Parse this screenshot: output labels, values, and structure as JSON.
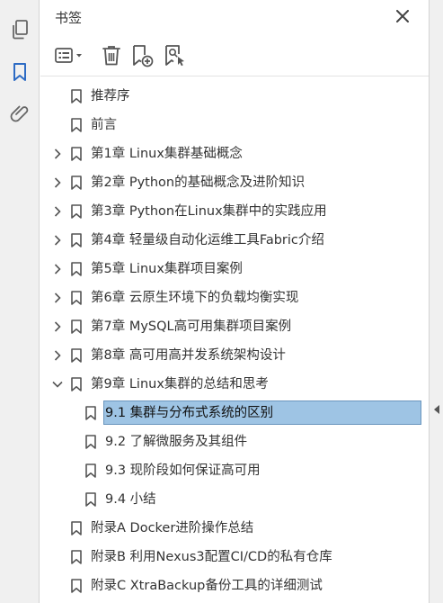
{
  "panel": {
    "title": "书签",
    "accent_color": "#2d6bc4",
    "selection_color": "#9ec4e4"
  },
  "left_nav": [
    {
      "name": "pages-icon",
      "active": false
    },
    {
      "name": "bookmark-icon",
      "active": true
    },
    {
      "name": "attachment-icon",
      "active": false
    }
  ],
  "toolbar": [
    {
      "name": "options-menu-button",
      "icon": "list-options-icon"
    },
    {
      "name": "delete-bookmark-button",
      "icon": "trash-icon"
    },
    {
      "name": "new-bookmark-button",
      "icon": "bookmark-add-icon"
    },
    {
      "name": "find-bookmark-button",
      "icon": "bookmark-search-icon"
    }
  ],
  "bookmarks": [
    {
      "label": "推荐序",
      "level": 0,
      "expander": "none",
      "selected": false
    },
    {
      "label": "前言",
      "level": 0,
      "expander": "none",
      "selected": false
    },
    {
      "label": "第1章 Linux集群基础概念",
      "level": 0,
      "expander": "collapsed",
      "selected": false
    },
    {
      "label": "第2章 Python的基础概念及进阶知识",
      "level": 0,
      "expander": "collapsed",
      "selected": false
    },
    {
      "label": "第3章 Python在Linux集群中的实践应用",
      "level": 0,
      "expander": "collapsed",
      "selected": false
    },
    {
      "label": "第4章 轻量级自动化运维工具Fabric介绍",
      "level": 0,
      "expander": "collapsed",
      "selected": false
    },
    {
      "label": "第5章 Linux集群项目案例",
      "level": 0,
      "expander": "collapsed",
      "selected": false
    },
    {
      "label": "第6章 云原生环境下的负载均衡实现",
      "level": 0,
      "expander": "collapsed",
      "selected": false
    },
    {
      "label": "第7章 MySQL高可用集群项目案例",
      "level": 0,
      "expander": "collapsed",
      "selected": false
    },
    {
      "label": "第8章 高可用高并发系统架构设计",
      "level": 0,
      "expander": "collapsed",
      "selected": false
    },
    {
      "label": "第9章 Linux集群的总结和思考",
      "level": 0,
      "expander": "expanded",
      "selected": false
    },
    {
      "label": "9.1 集群与分布式系统的区别",
      "level": 1,
      "expander": "none",
      "selected": true
    },
    {
      "label": "9.2 了解微服务及其组件",
      "level": 1,
      "expander": "none",
      "selected": false
    },
    {
      "label": "9.3 现阶段如何保证高可用",
      "level": 1,
      "expander": "none",
      "selected": false
    },
    {
      "label": "9.4 小结",
      "level": 1,
      "expander": "none",
      "selected": false
    },
    {
      "label": "附录A Docker进阶操作总结",
      "level": 0,
      "expander": "none",
      "selected": false
    },
    {
      "label": "附录B 利用Nexus3配置CI/CD的私有仓库",
      "level": 0,
      "expander": "none",
      "selected": false
    },
    {
      "label": "附录C XtraBackup备份工具的详细测试",
      "level": 0,
      "expander": "none",
      "selected": false
    }
  ]
}
